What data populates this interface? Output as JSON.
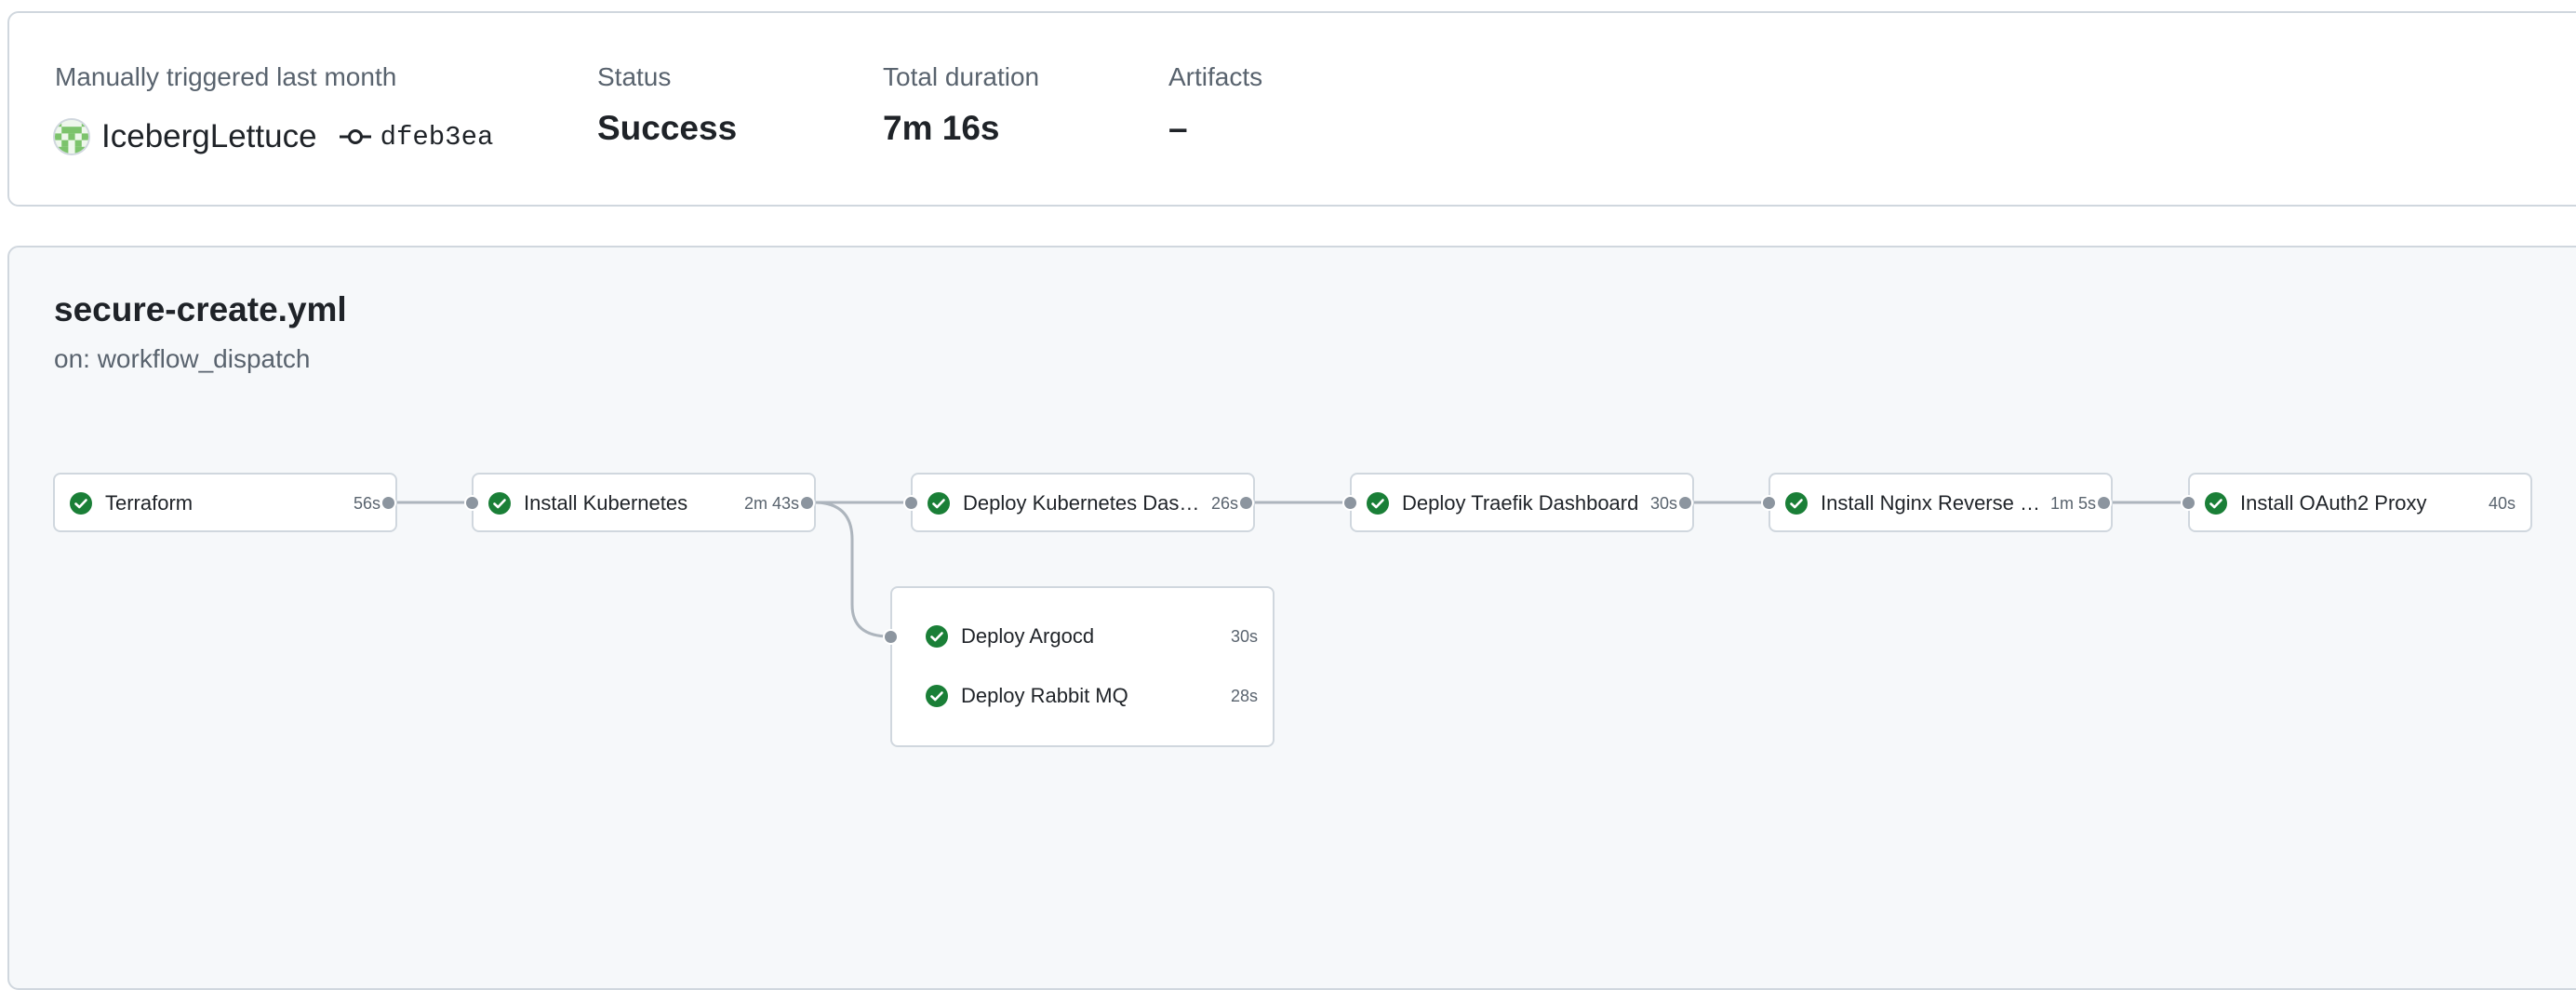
{
  "summary": {
    "trigger_label": "Manually triggered last month",
    "actor": "IcebergLettuce",
    "commit": "dfeb3ea",
    "status_label": "Status",
    "status_value": "Success",
    "duration_label": "Total duration",
    "duration_value": "7m 16s",
    "artifacts_label": "Artifacts",
    "artifacts_value": "–"
  },
  "workflow": {
    "file": "secure-create.yml",
    "trigger": "on: workflow_dispatch"
  },
  "jobs": [
    {
      "name": "Terraform",
      "duration": "56s",
      "status": "success"
    },
    {
      "name": "Install Kubernetes",
      "duration": "2m 43s",
      "status": "success"
    },
    {
      "name": "Deploy Kubernetes Dashboard",
      "duration": "26s",
      "status": "success"
    },
    {
      "name": "Deploy Traefik Dashboard",
      "duration": "30s",
      "status": "success"
    },
    {
      "name": "Install Nginx Reverse Proxy",
      "duration": "1m 5s",
      "status": "success"
    },
    {
      "name": "Install OAuth2 Proxy",
      "duration": "40s",
      "status": "success"
    }
  ],
  "parallel_jobs": [
    {
      "name": "Deploy Argocd",
      "duration": "30s",
      "status": "success"
    },
    {
      "name": "Deploy Rabbit MQ",
      "duration": "28s",
      "status": "success"
    }
  ],
  "colors": {
    "success": "#1a7f37",
    "border": "#d0d7de",
    "connector": "#8c959f",
    "panel_bg": "#f6f8fa"
  },
  "icons": {
    "success": "check-circle-icon",
    "commit": "git-commit-icon",
    "avatar": "identicon-avatar"
  }
}
